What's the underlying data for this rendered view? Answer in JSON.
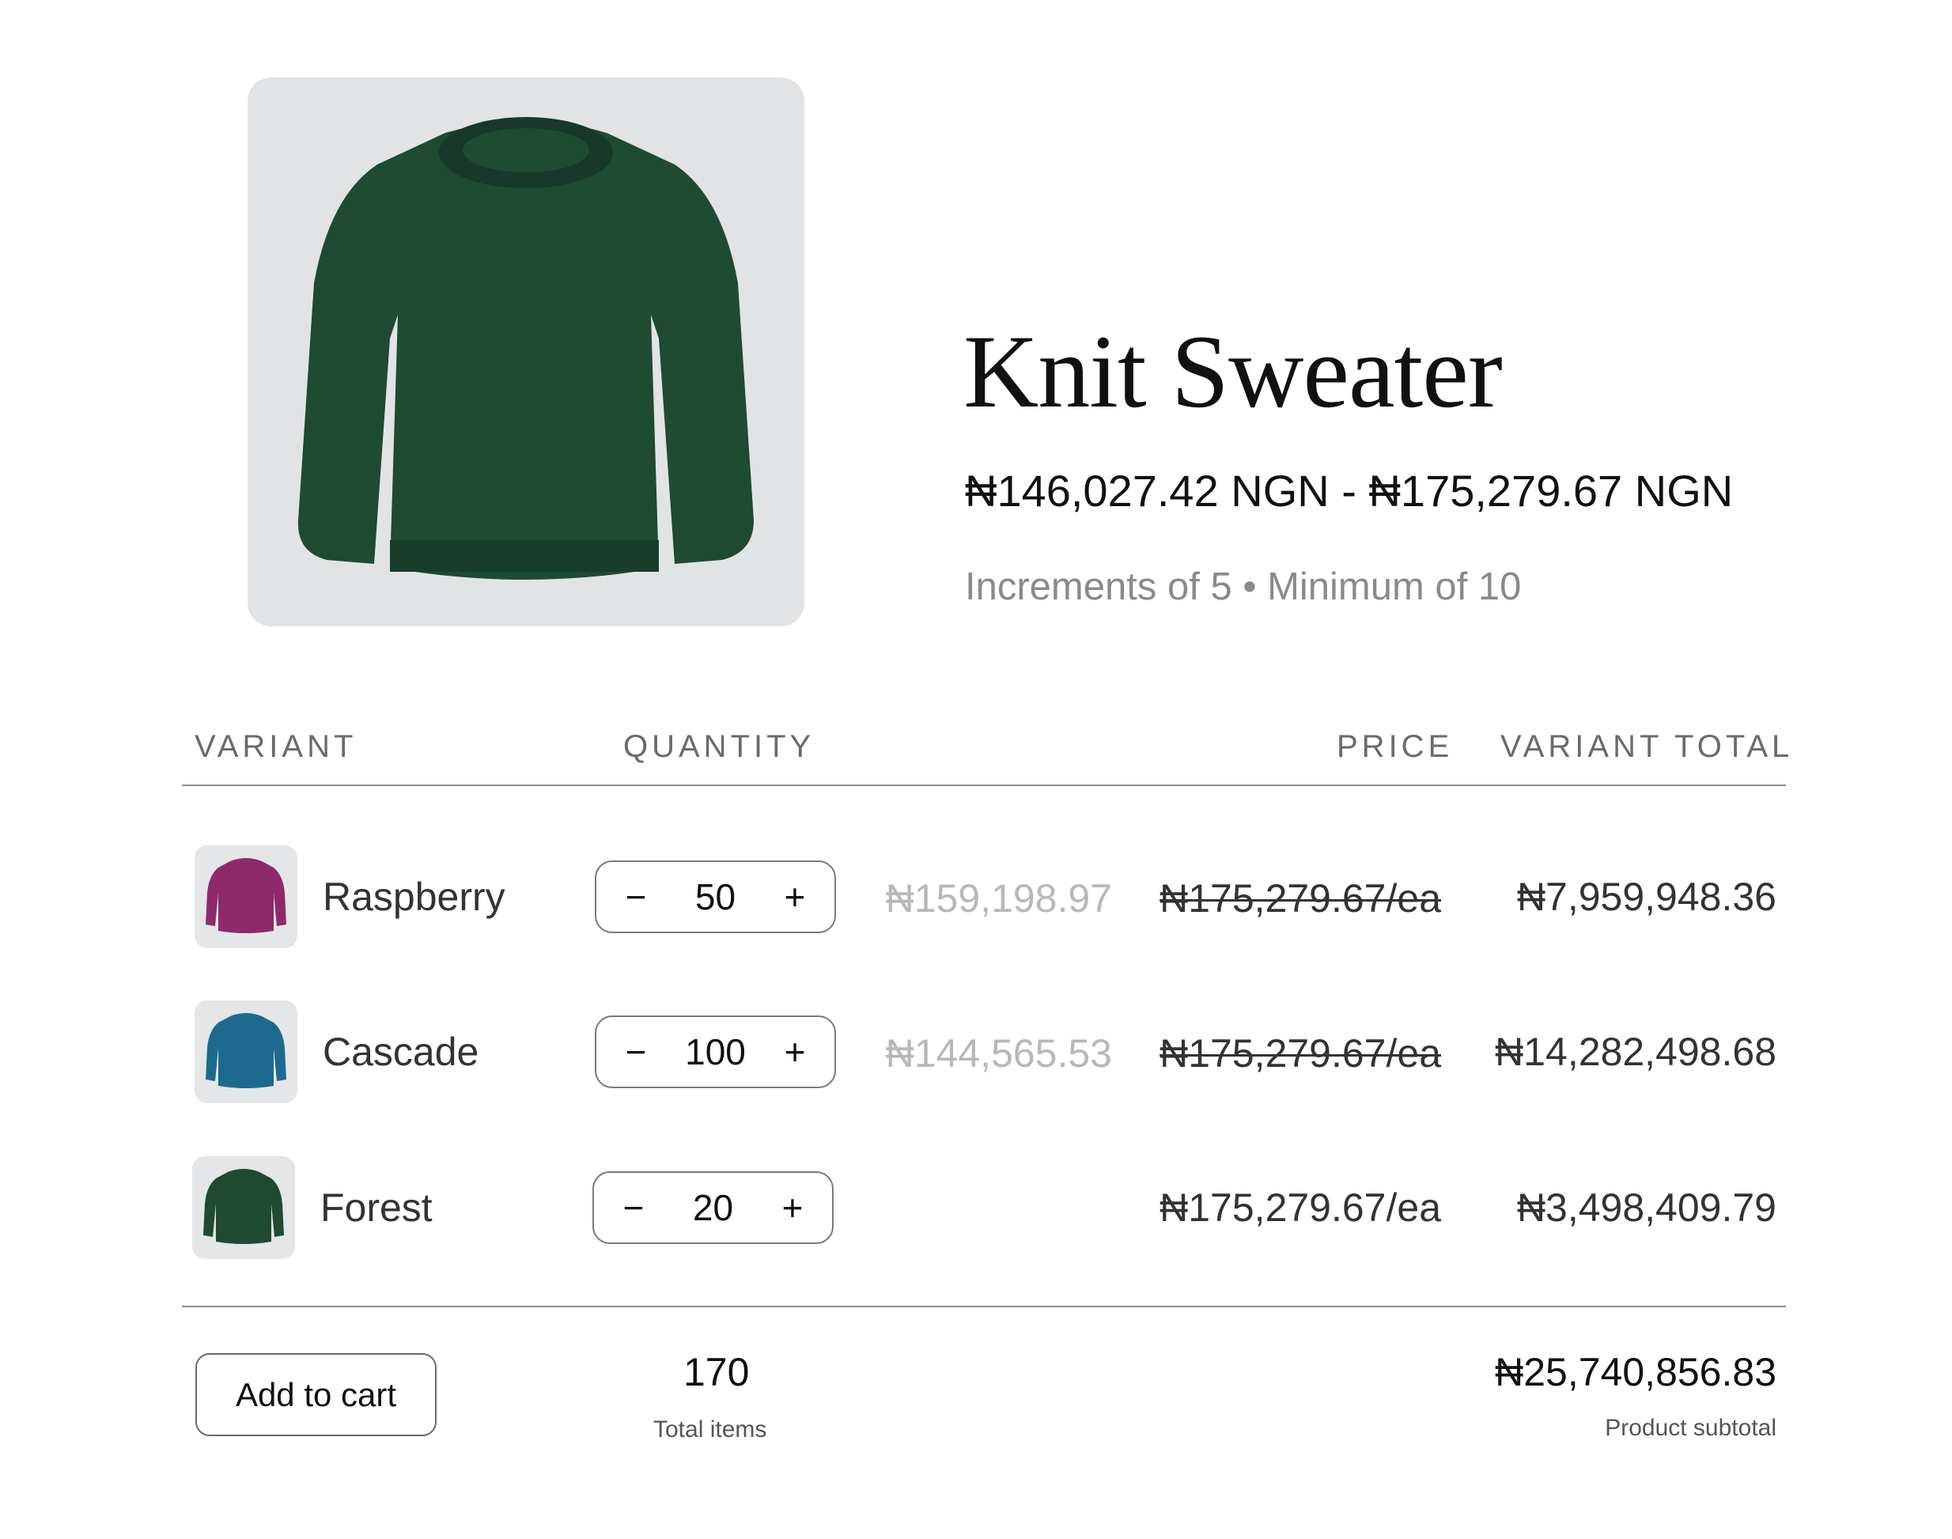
{
  "product": {
    "title": "Knit Sweater",
    "price_range": "₦146,027.42 NGN - ₦175,279.67 NGN",
    "rules": "Increments of 5 • Minimum of 10",
    "image_icon": "sweater-photo-forest",
    "colors": {
      "forest": "#1f4a34",
      "raspberry": "#8e2a6a",
      "cascade": "#1e6a8e"
    }
  },
  "table": {
    "headers": {
      "variant": "VARIANT",
      "quantity": "QUANTITY",
      "price": "PRICE",
      "variant_total": "VARIANT TOTAL"
    },
    "rows": [
      {
        "name": "Raspberry",
        "quantity": "50",
        "discounted_price": "₦159,198.97",
        "price": "₦175,279.67/ea",
        "price_struck": true,
        "total": "₦7,959,948.36",
        "minus": "−",
        "plus": "+"
      },
      {
        "name": "Cascade",
        "quantity": "100",
        "discounted_price": "₦144,565.53",
        "price": "₦175,279.67/ea",
        "price_struck": true,
        "total": "₦14,282,498.68",
        "minus": "−",
        "plus": "+"
      },
      {
        "name": "Forest",
        "quantity": "20",
        "discounted_price": "",
        "price": "₦175,279.67/ea",
        "price_struck": false,
        "total": "₦3,498,409.79",
        "minus": "−",
        "plus": "+"
      }
    ]
  },
  "footer": {
    "add_to_cart": "Add to cart",
    "total_items": "170",
    "total_items_label": "Total items",
    "subtotal": "₦25,740,856.83",
    "subtotal_label": "Product subtotal"
  }
}
